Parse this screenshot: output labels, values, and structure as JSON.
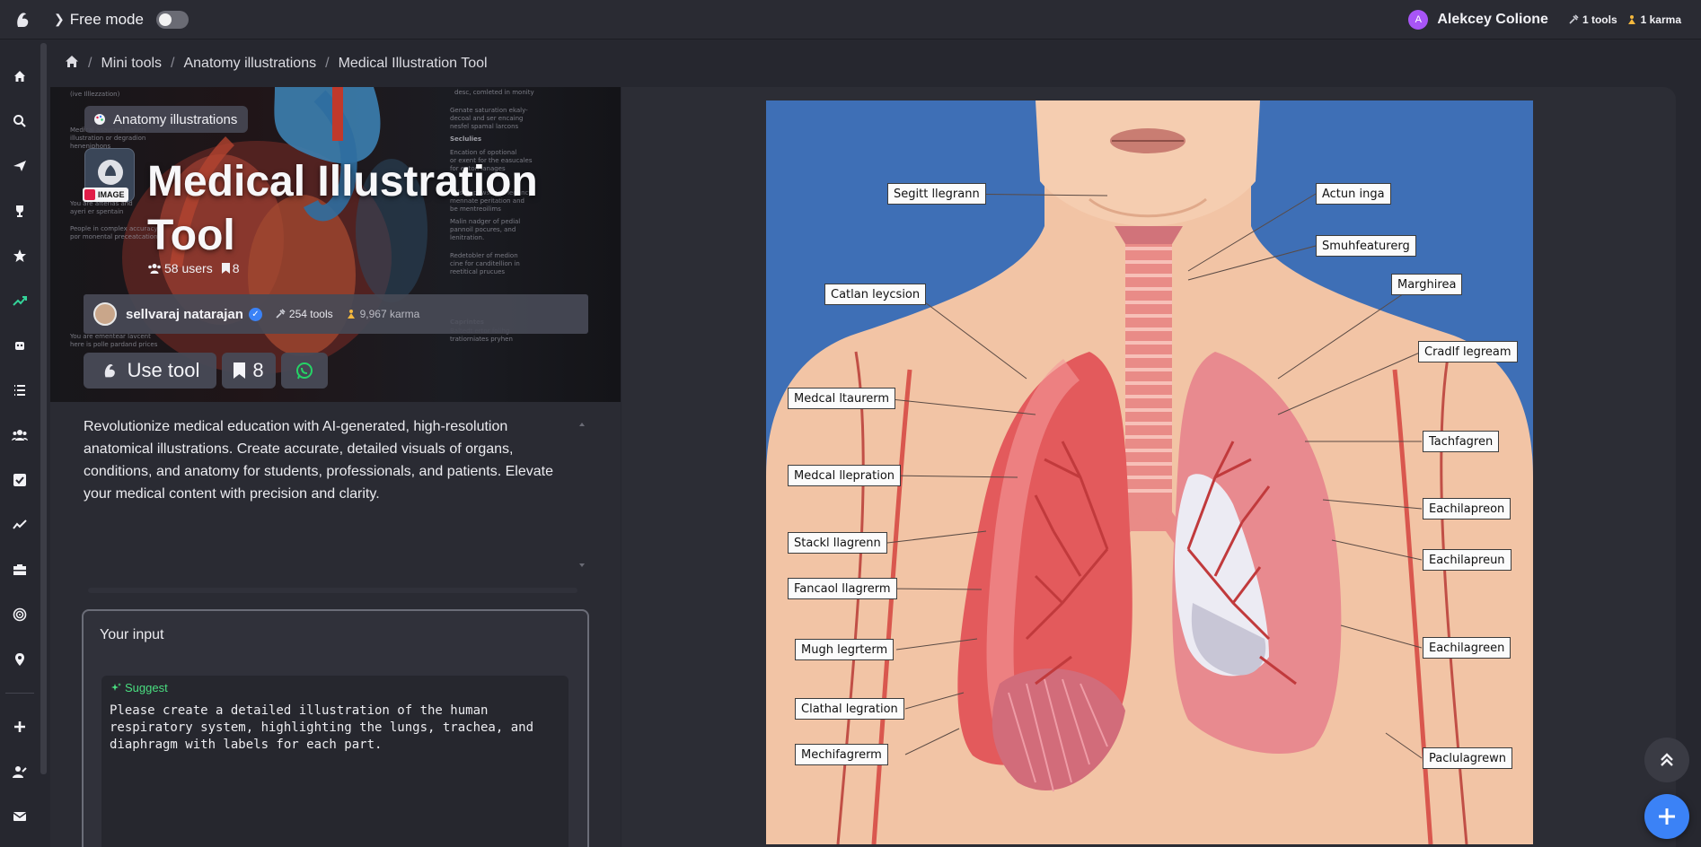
{
  "topbar": {
    "free_mode_label": "Free mode",
    "user_initial": "A",
    "user_name": "Alekcey Colione",
    "tools_count": "1 tools",
    "karma_count": "1 karma"
  },
  "breadcrumb": {
    "items": [
      "Mini tools",
      "Anatomy illustrations",
      "Medical Illustration Tool"
    ]
  },
  "hero": {
    "category_chip": "Anatomy illustrations",
    "image_badge": "IMAGE",
    "title": "Medical Illustration Tool",
    "users": "58 users",
    "bookmarks": "8"
  },
  "author": {
    "name": "sellvaraj natarajan",
    "tools": "254 tools",
    "karma": "9,967 karma"
  },
  "actions": {
    "use_tool_label": "Use tool",
    "save_count": "8"
  },
  "description": "Revolutionize medical education with AI-generated, high-resolution anatomical illustrations. Create accurate, detailed visuals of organs, conditions, and anatomy for students, professionals, and patients. Elevate your medical content with precision and clarity.",
  "input": {
    "title": "Your input",
    "suggest_label": "Suggest",
    "prompt": "Please create a detailed illustration of the human respiratory system, highlighting the lungs, trachea, and diaphragm with labels for each part."
  },
  "illustration_labels": {
    "left": [
      "Segitt llegrann",
      "Catlan leycsion",
      "Medcal ltaurerm",
      "Medcal llepration",
      "Stackl llagrenn",
      "Fancaol llagrerm",
      "Mugh legrterm",
      "Clathal legration",
      "Mechifagrerm"
    ],
    "right": [
      "Actun inga",
      "Smuhfeaturerg",
      "Marghirea",
      "Cradlf legream",
      "Tachfagren",
      "Eachilapreon",
      "Eachilapreun",
      "Eachilagreen",
      "Paclulagrewn"
    ]
  },
  "colors": {
    "background": "#26272f",
    "accent_blue": "#3b82f6",
    "suggest_green": "#4ade80",
    "illustration_bg": "#3e6fb6"
  },
  "icons": {
    "sidebar": [
      "home-icon",
      "search-icon",
      "plane-icon",
      "trophy-icon",
      "star-icon",
      "trending-icon",
      "robot-icon",
      "list-icon",
      "users-icon",
      "check-icon",
      "chart-icon",
      "toolbox-icon",
      "target-icon",
      "map-pin-icon",
      "plus-icon",
      "user-edit-icon",
      "mail-icon"
    ]
  }
}
